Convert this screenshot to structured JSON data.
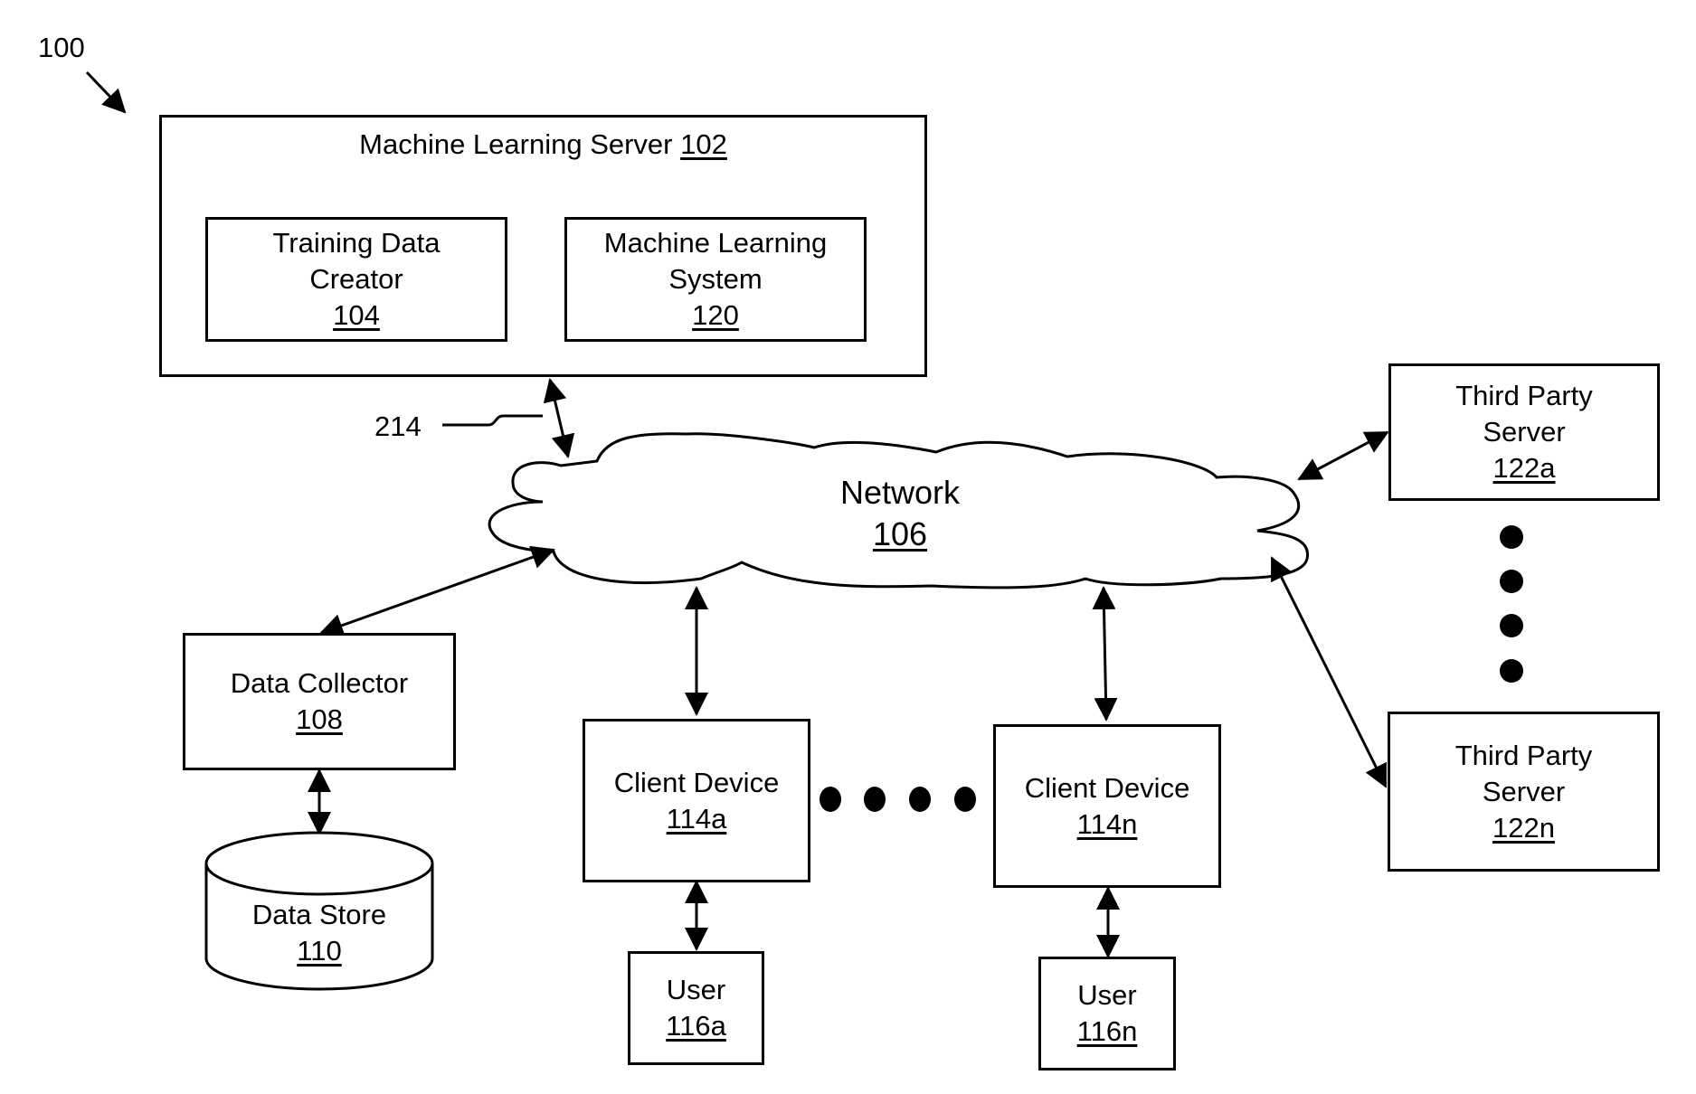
{
  "figure_ref": "100",
  "connection_ref": "214",
  "ml_server": {
    "title": "Machine Learning Server",
    "ref": "102"
  },
  "training_data_creator": {
    "line1": "Training Data",
    "line2": "Creator",
    "ref": "104"
  },
  "ml_system": {
    "line1": "Machine Learning",
    "line2": "System",
    "ref": "120"
  },
  "network": {
    "label": "Network",
    "ref": "106"
  },
  "data_collector": {
    "label": "Data Collector",
    "ref": "108"
  },
  "data_store": {
    "label": "Data Store",
    "ref": "110"
  },
  "client_a": {
    "label": "Client Device",
    "ref": "114a"
  },
  "client_n": {
    "label": "Client Device",
    "ref": "114n"
  },
  "user_a": {
    "label": "User",
    "ref": "116a"
  },
  "user_n": {
    "label": "User",
    "ref": "116n"
  },
  "third_party_a": {
    "line1": "Third Party",
    "line2": "Server",
    "ref": "122a"
  },
  "third_party_n": {
    "line1": "Third Party",
    "line2": "Server",
    "ref": "122n"
  },
  "ellipsis_icons": [
    "horizontal-ellipsis-icon",
    "vertical-ellipsis-icon"
  ]
}
